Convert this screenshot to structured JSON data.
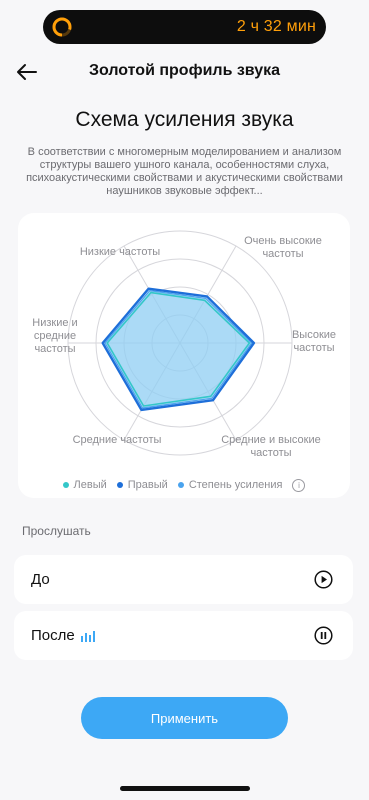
{
  "status_bar": {
    "time": "2 ч 32 мин",
    "accent": "#ff9f0a"
  },
  "header": {
    "back_icon": "arrow-left-icon",
    "title": "Золотой профиль звука"
  },
  "main": {
    "heading": "Схема усиления звука",
    "description": "В соответствии с многомерным моделированием и анализом структуры вашего ушного канала, особенностями слуха, психоакустическими свойствами и акустическими свойствами наушников звуковые эффект..."
  },
  "chart_data": {
    "type": "radar",
    "axes": [
      "Низкие частоты",
      "Очень высокие частоты",
      "Высокие частоты",
      "Средние и высокие частоты",
      "Средние частоты",
      "Низкие и средние частоты"
    ],
    "range": [
      0,
      1
    ],
    "rings": 4,
    "series": [
      {
        "name": "Левый",
        "color": "#34c7c9",
        "values": [
          0.52,
          0.44,
          0.62,
          0.55,
          0.65,
          0.65
        ]
      },
      {
        "name": "Правый",
        "color": "#1e6fd9",
        "values": [
          0.56,
          0.48,
          0.66,
          0.59,
          0.69,
          0.69
        ]
      },
      {
        "name": "Степень усиления",
        "color": "#4aa3ee",
        "values": [
          0.54,
          0.46,
          0.64,
          0.57,
          0.67,
          0.67
        ]
      }
    ],
    "colors": {
      "fill": "#8fcdf3",
      "grid": "#d6d6db"
    }
  },
  "legend": {
    "left": "Левый",
    "right": "Правый",
    "gain": "Степень усиления",
    "info_icon": "info-icon"
  },
  "listen": {
    "label": "Прослушать",
    "before": {
      "label": "До",
      "icon": "play-icon"
    },
    "after": {
      "label": "После",
      "icon": "pause-icon",
      "indicator_icon": "equalizer-bars-icon"
    }
  },
  "apply_label": "Применить",
  "accent_color": "#3da8f5"
}
